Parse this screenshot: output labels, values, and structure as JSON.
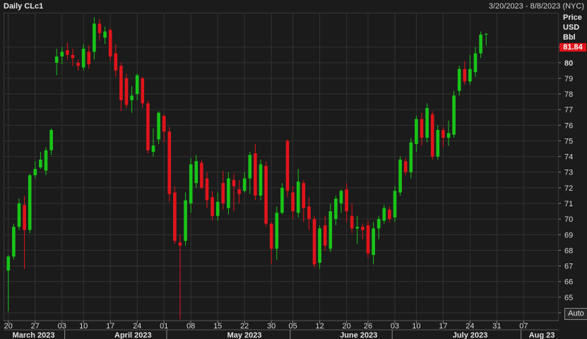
{
  "header": {
    "title": "Daily CLc1",
    "date_range": "3/20/2023 - 8/8/2023 (NYC)"
  },
  "axis_header": {
    "line1": "Price",
    "line2": "USD",
    "line3": "Bbl"
  },
  "last_price": "81.84",
  "auto_button": "Auto",
  "colors": {
    "background": "#1b1b1b",
    "up": "#19c419",
    "down": "#e0141b",
    "grid": "#323232"
  },
  "chart_data": {
    "type": "candlestick",
    "title": "Daily CLc1",
    "ylabel": "Price USD Bbl",
    "ylim": [
      63.5,
      83.2
    ],
    "y_ticks": [
      64,
      65,
      66,
      67,
      68,
      69,
      70,
      71,
      72,
      73,
      74,
      75,
      76,
      77,
      78,
      79,
      80,
      81
    ],
    "x_ticks": [
      {
        "index": 0,
        "label": "20"
      },
      {
        "index": 5,
        "label": "27"
      },
      {
        "index": 10,
        "label": "03"
      },
      {
        "index": 14,
        "label": "10"
      },
      {
        "index": 19,
        "label": "17"
      },
      {
        "index": 24,
        "label": "24"
      },
      {
        "index": 29,
        "label": "01"
      },
      {
        "index": 34,
        "label": "08"
      },
      {
        "index": 39,
        "label": "15"
      },
      {
        "index": 44,
        "label": "22"
      },
      {
        "index": 49,
        "label": "30"
      },
      {
        "index": 53,
        "label": "05"
      },
      {
        "index": 58,
        "label": "12"
      },
      {
        "index": 63,
        "label": "20"
      },
      {
        "index": 67,
        "label": "26"
      },
      {
        "index": 72,
        "label": "03"
      },
      {
        "index": 76,
        "label": "10"
      },
      {
        "index": 81,
        "label": "17"
      },
      {
        "index": 86,
        "label": "24"
      },
      {
        "index": 91,
        "label": "31"
      },
      {
        "index": 96,
        "label": "07"
      }
    ],
    "months": [
      {
        "index": 0.5,
        "label": "March 2023"
      },
      {
        "index": 19.5,
        "label": "April 2023"
      },
      {
        "index": 40.5,
        "label": "May 2023"
      },
      {
        "index": 61.5,
        "label": "June 2023"
      },
      {
        "index": 82.5,
        "label": "July 2023"
      },
      {
        "index": 96.7,
        "label": "Aug 23"
      }
    ],
    "month_separators": [
      10.5,
      29.5,
      52.5,
      71.5,
      95.5
    ],
    "candles": [
      [
        66.7,
        67.6,
        64.1,
        67.7
      ],
      [
        67.6,
        69.5,
        67.4,
        69.7
      ],
      [
        69.5,
        71.0,
        69.3,
        71.3
      ],
      [
        70.9,
        69.3,
        66.8,
        71.5
      ],
      [
        69.3,
        72.8,
        69.1,
        72.9
      ],
      [
        72.8,
        73.2,
        72.6,
        73.7
      ],
      [
        73.3,
        73.8,
        73.2,
        74.3
      ],
      [
        73.1,
        74.4,
        72.8,
        74.6
      ],
      [
        74.4,
        75.7,
        74.1,
        75.8
      ],
      [
        80.0,
        80.4,
        79.2,
        80.9
      ],
      [
        80.4,
        80.7,
        79.9,
        81.0
      ],
      [
        80.8,
        80.5,
        80.2,
        81.3
      ],
      [
        80.5,
        80.3,
        79.8,
        80.9
      ],
      [
        80.0,
        79.8,
        79.5,
        80.2
      ],
      [
        79.7,
        80.9,
        79.5,
        81.2
      ],
      [
        80.7,
        79.9,
        79.6,
        81.1
      ],
      [
        80.7,
        82.5,
        80.2,
        82.9
      ],
      [
        82.5,
        81.9,
        81.4,
        82.8
      ],
      [
        81.6,
        82.0,
        81.2,
        82.3
      ],
      [
        82.1,
        80.4,
        80.1,
        82.2
      ],
      [
        80.6,
        79.5,
        79.1,
        81.2
      ],
      [
        79.8,
        77.6,
        76.9,
        80.0
      ],
      [
        79.0,
        77.3,
        77.1,
        79.3
      ],
      [
        77.6,
        77.9,
        76.8,
        78.5
      ],
      [
        78.0,
        79.2,
        77.6,
        79.3
      ],
      [
        79.0,
        77.4,
        77.1,
        79.1
      ],
      [
        77.4,
        74.4,
        74.2,
        77.6
      ],
      [
        74.3,
        74.7,
        74.0,
        75.8
      ],
      [
        75.1,
        76.8,
        74.8,
        76.9
      ],
      [
        76.6,
        75.6,
        74.9,
        76.7
      ],
      [
        75.6,
        71.6,
        71.1,
        75.9
      ],
      [
        71.7,
        68.6,
        68.4,
        72.1
      ],
      [
        68.5,
        68.3,
        63.6,
        69.0
      ],
      [
        68.6,
        71.2,
        68.3,
        71.7
      ],
      [
        71.0,
        73.5,
        70.4,
        73.9
      ],
      [
        72.3,
        73.7,
        72.0,
        74.1
      ],
      [
        73.6,
        72.0,
        71.9,
        73.8
      ],
      [
        72.6,
        71.2,
        70.7,
        73.0
      ],
      [
        71.4,
        70.2,
        69.9,
        71.8
      ],
      [
        70.2,
        71.1,
        69.9,
        71.7
      ],
      [
        72.3,
        71.0,
        70.6,
        73.1
      ],
      [
        70.7,
        72.6,
        70.3,
        73.0
      ],
      [
        72.5,
        72.1,
        70.5,
        72.9
      ],
      [
        71.9,
        71.6,
        71.0,
        72.5
      ],
      [
        71.8,
        72.6,
        71.7,
        73.0
      ],
      [
        72.6,
        74.1,
        71.6,
        74.3
      ],
      [
        74.2,
        71.5,
        71.2,
        74.8
      ],
      [
        71.5,
        73.5,
        71.2,
        73.8
      ],
      [
        73.4,
        69.7,
        69.5,
        73.7
      ],
      [
        69.7,
        68.1,
        67.1,
        69.8
      ],
      [
        68.1,
        70.4,
        67.4,
        70.8
      ],
      [
        70.4,
        72.0,
        70.3,
        72.3
      ],
      [
        75.0,
        71.8,
        71.4,
        75.1
      ],
      [
        71.7,
        70.5,
        70.0,
        72.1
      ],
      [
        70.4,
        72.4,
        70.1,
        73.2
      ],
      [
        72.3,
        70.7,
        69.8,
        72.5
      ],
      [
        70.8,
        70.0,
        69.3,
        71.4
      ],
      [
        70.0,
        67.1,
        66.9,
        70.2
      ],
      [
        67.2,
        69.4,
        66.8,
        69.6
      ],
      [
        69.6,
        68.3,
        68.0,
        70.2
      ],
      [
        68.1,
        70.5,
        67.9,
        71.0
      ],
      [
        70.0,
        71.3,
        69.6,
        71.5
      ],
      [
        71.0,
        71.8,
        70.4,
        71.9
      ],
      [
        71.9,
        70.5,
        69.8,
        72.3
      ],
      [
        70.2,
        69.4,
        69.1,
        71.0
      ],
      [
        69.4,
        69.5,
        68.4,
        70.2
      ],
      [
        69.5,
        69.3,
        68.7,
        69.7
      ],
      [
        69.6,
        67.8,
        67.5,
        69.9
      ],
      [
        67.7,
        69.4,
        67.1,
        69.8
      ],
      [
        69.4,
        70.0,
        68.7,
        70.2
      ],
      [
        69.9,
        70.7,
        69.7,
        70.9
      ],
      [
        70.6,
        70.0,
        69.8,
        70.8
      ],
      [
        70.1,
        71.8,
        69.8,
        72.1
      ],
      [
        71.7,
        73.8,
        71.5,
        74.0
      ],
      [
        73.7,
        73.0,
        72.8,
        73.9
      ],
      [
        73.0,
        74.9,
        72.6,
        75.2
      ],
      [
        74.8,
        76.4,
        74.3,
        76.6
      ],
      [
        76.4,
        75.2,
        74.7,
        76.8
      ],
      [
        75.2,
        77.1,
        74.9,
        77.4
      ],
      [
        76.7,
        74.0,
        73.8,
        76.9
      ],
      [
        74.0,
        75.7,
        73.8,
        76.0
      ],
      [
        75.7,
        75.2,
        74.6,
        75.9
      ],
      [
        75.2,
        75.5,
        74.7,
        76.3
      ],
      [
        75.4,
        77.9,
        75.2,
        78.2
      ],
      [
        78.2,
        79.6,
        77.9,
        79.8
      ],
      [
        79.6,
        78.8,
        78.6,
        80.1
      ],
      [
        78.8,
        79.6,
        78.6,
        80.5
      ],
      [
        79.4,
        80.6,
        79.1,
        81.0
      ],
      [
        80.6,
        81.8,
        80.3,
        82.0
      ],
      [
        81.8,
        81.84,
        81.1,
        81.9
      ]
    ]
  }
}
